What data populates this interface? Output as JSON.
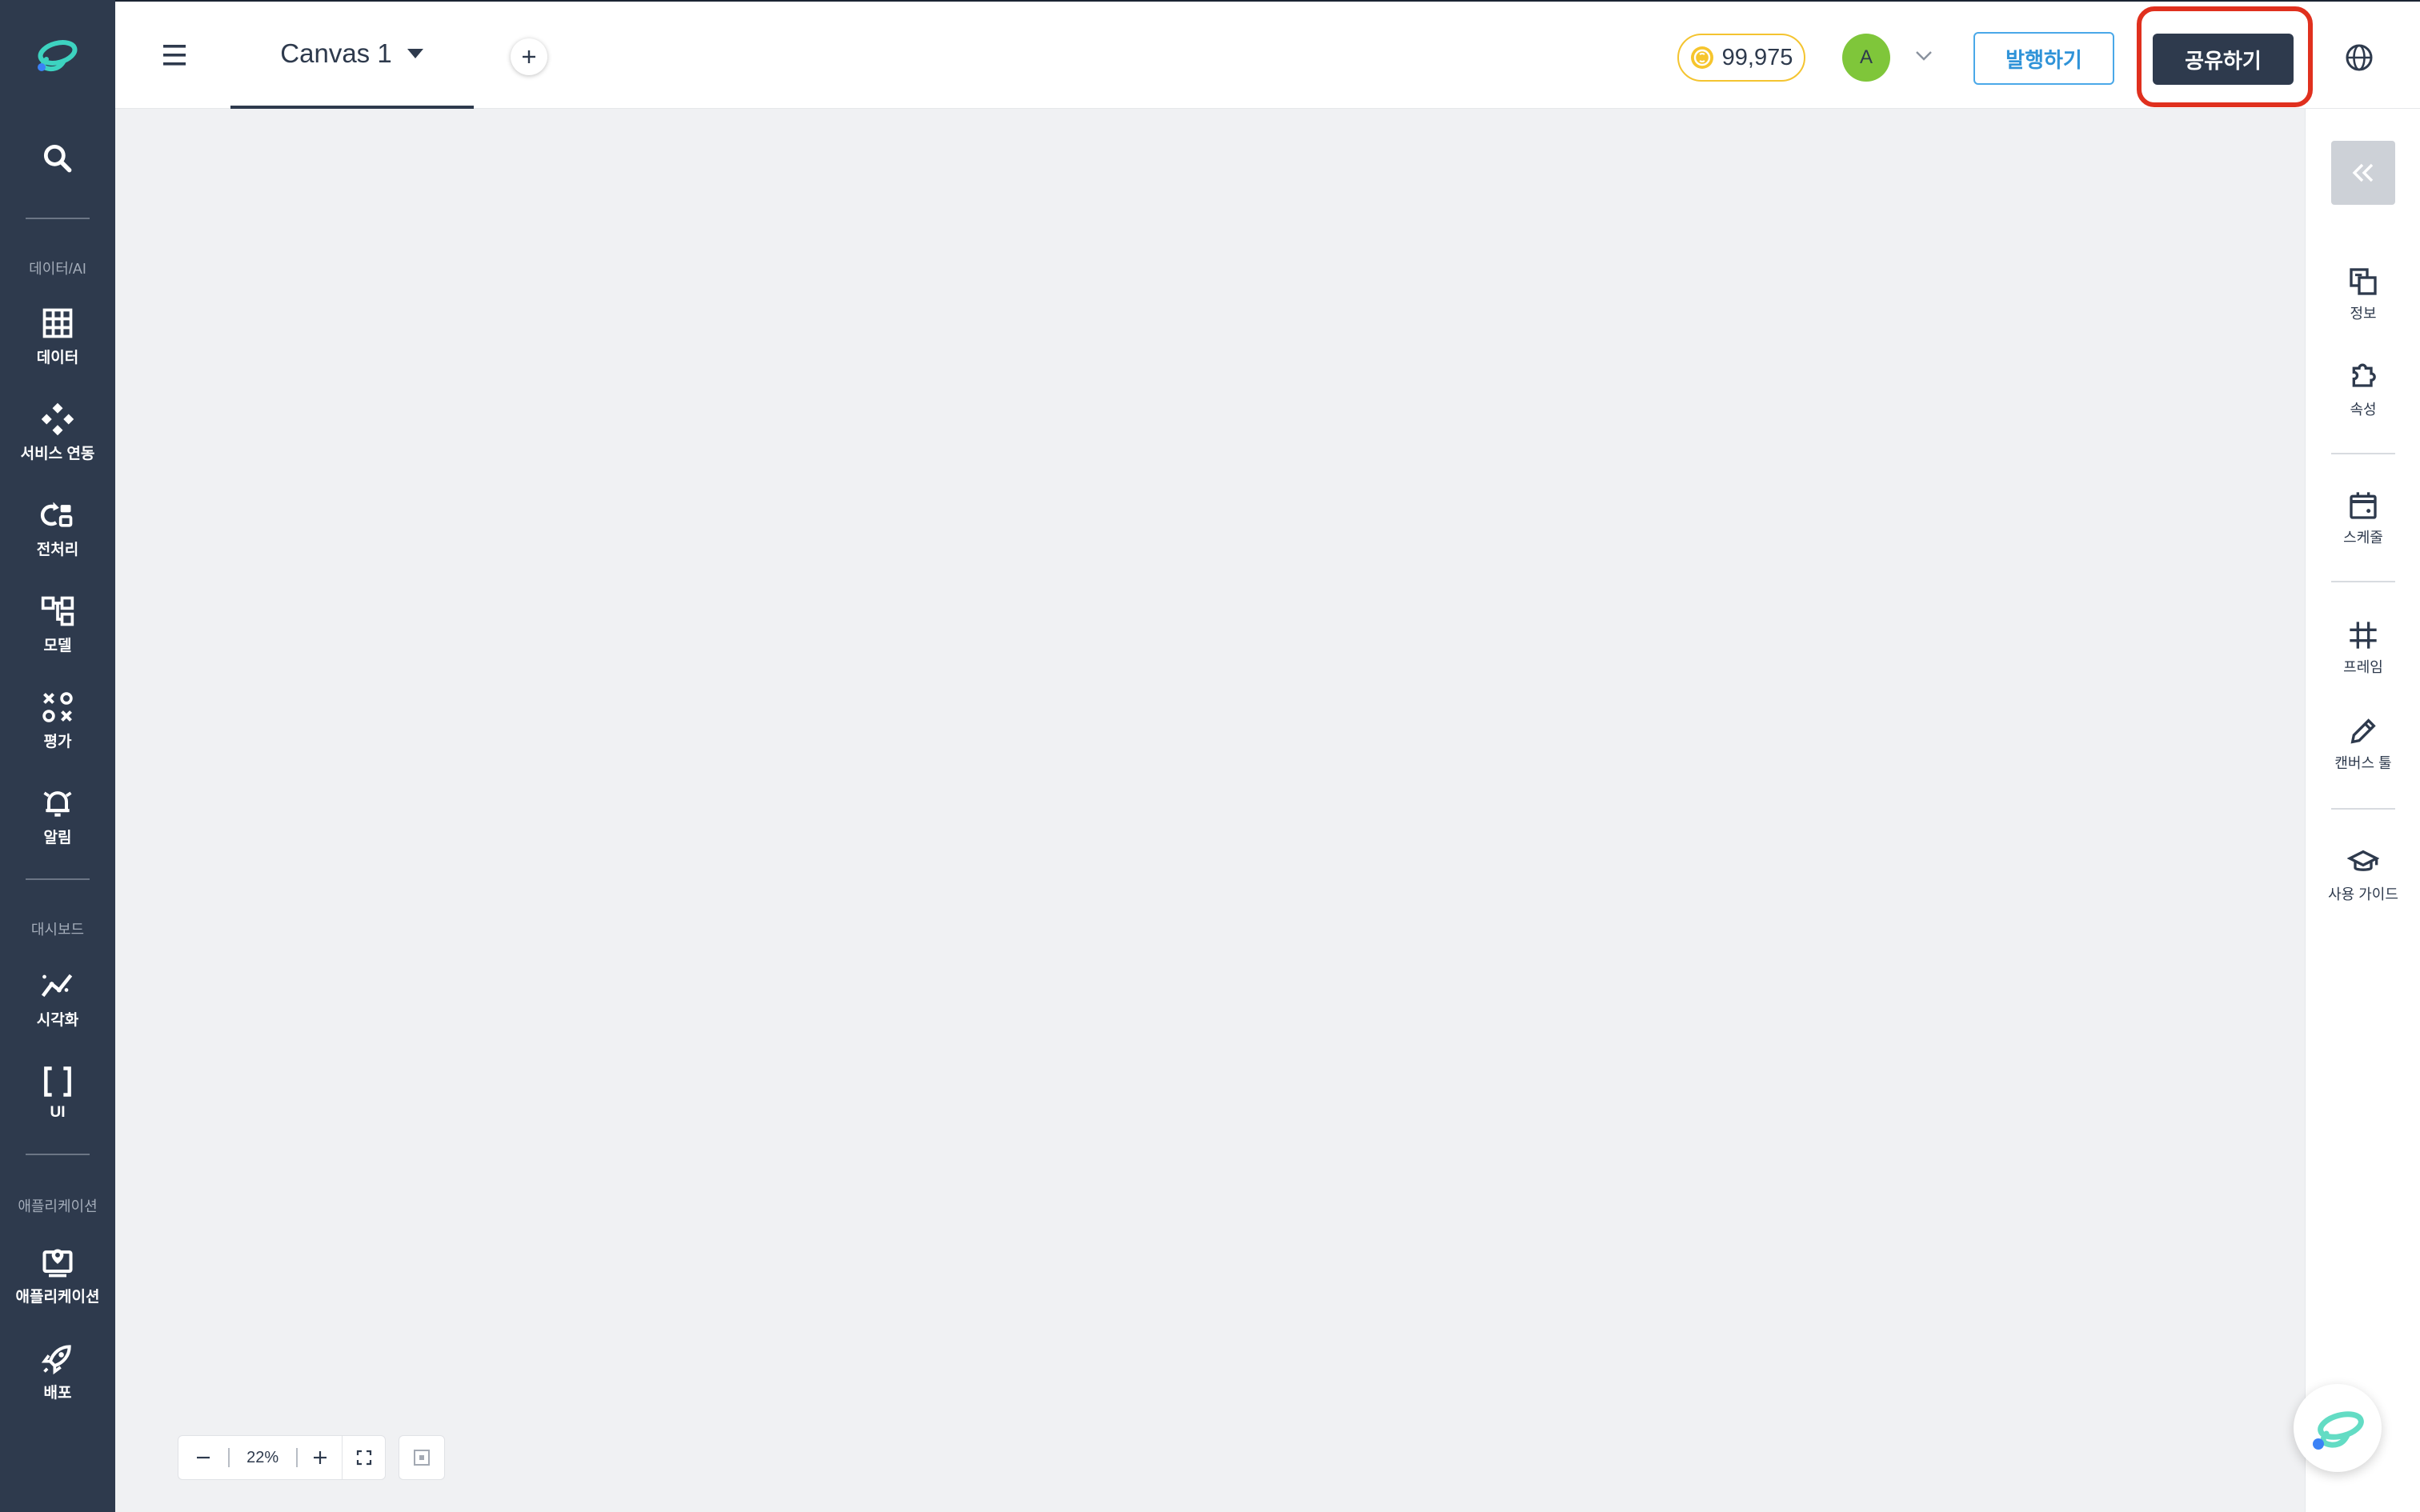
{
  "sidebar": {
    "items": [
      {
        "label": "데이터"
      },
      {
        "label": "서비스 연동"
      },
      {
        "label": "전처리"
      },
      {
        "label": "모델"
      },
      {
        "label": "평가"
      },
      {
        "label": "알림"
      },
      {
        "label": "시각화"
      },
      {
        "label": "UI"
      },
      {
        "label": "애플리케이션"
      },
      {
        "label": "배포"
      }
    ],
    "sections": [
      "데이터/AI",
      "대시보드",
      "애플리케이션"
    ]
  },
  "header": {
    "tab_label": "Canvas 1",
    "credit": "99,975",
    "avatar_initial": "A",
    "publish_label": "발행하기",
    "share_label": "공유하기"
  },
  "right_panel": {
    "items": [
      {
        "label": "정보"
      },
      {
        "label": "속성"
      },
      {
        "label": "스케줄"
      },
      {
        "label": "프레임"
      },
      {
        "label": "캔버스 툴"
      },
      {
        "label": "사용 가이드"
      }
    ]
  },
  "zoom": {
    "level": "22%"
  },
  "colors": {
    "sidebar_bg": "#2e3a4d",
    "canvas_bg": "#f0f1f3",
    "accent_blue": "#2f93d8",
    "highlight_red": "#e0301e",
    "avatar_green": "#7fc63a",
    "credit_gold": "#f4c430"
  }
}
